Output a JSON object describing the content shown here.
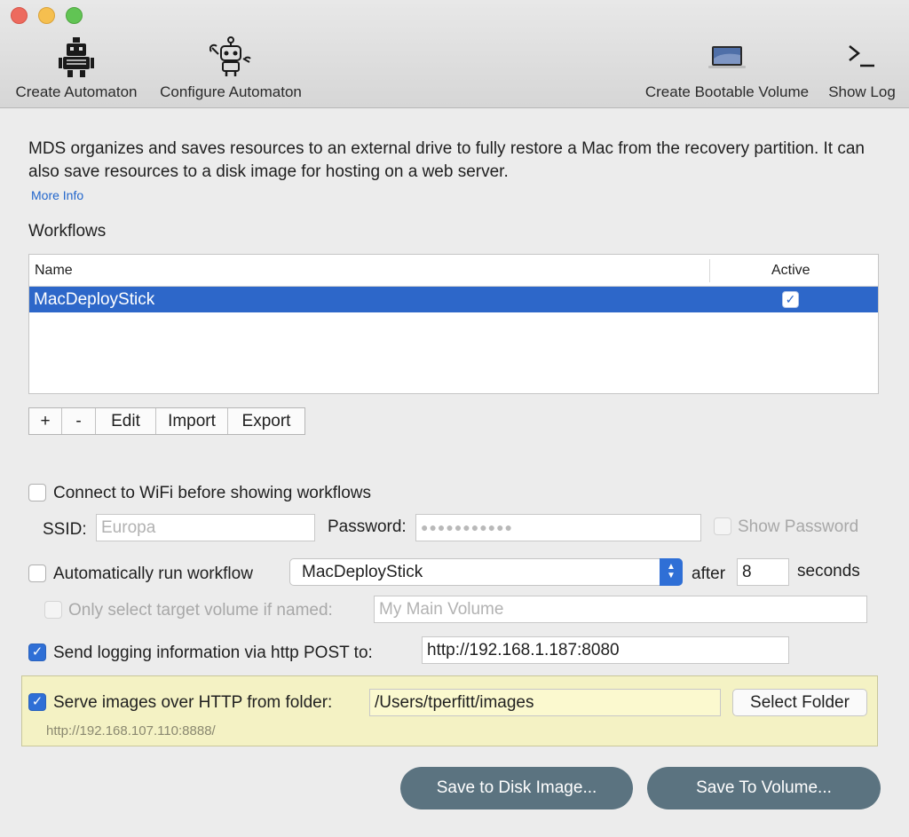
{
  "toolbar": {
    "create_automaton": "Create Automaton",
    "configure_automaton": "Configure Automaton",
    "create_bootable_volume": "Create Bootable Volume",
    "show_log": "Show Log"
  },
  "description": "MDS organizes and saves resources to an external drive to fully restore a Mac from the recovery partition. It can also save resources to a disk image for hosting on a web server.",
  "more_info": "More Info",
  "workflows": {
    "title": "Workflows",
    "columns": {
      "name": "Name",
      "active": "Active"
    },
    "rows": [
      {
        "name": "MacDeployStick",
        "active": true
      }
    ],
    "buttons": {
      "add": "+",
      "remove": "-",
      "edit": "Edit",
      "import": "Import",
      "export": "Export"
    }
  },
  "wifi": {
    "label": "Connect to WiFi before showing workflows",
    "checked": false,
    "ssid_label": "SSID:",
    "ssid_placeholder": "Europa",
    "password_label": "Password:",
    "password_dots": "●●●●●●●●●●●",
    "show_password": "Show Password"
  },
  "autorun": {
    "label": "Automatically run workflow",
    "checked": false,
    "workflow": "MacDeployStick",
    "after_label": "after",
    "seconds_value": "8",
    "seconds_label": "seconds",
    "only_label": "Only select target volume if named:",
    "volume_placeholder": "My Main Volume"
  },
  "logging": {
    "label": "Send logging information via http POST to:",
    "checked": true,
    "url": "http://192.168.1.187:8080"
  },
  "serve": {
    "label": "Serve images over HTTP from folder:",
    "checked": true,
    "folder": "/Users/tperfitt/images",
    "select_button": "Select Folder",
    "served_url": "http://192.168.107.110:8888/"
  },
  "actions": {
    "save_disk_image": "Save to Disk Image...",
    "save_volume": "Save To Volume..."
  },
  "colors": {
    "accent": "#2f6fd6",
    "selection": "#2d67c9",
    "highlight_bg": "#f4f2c4",
    "action_button": "#5b7380"
  }
}
